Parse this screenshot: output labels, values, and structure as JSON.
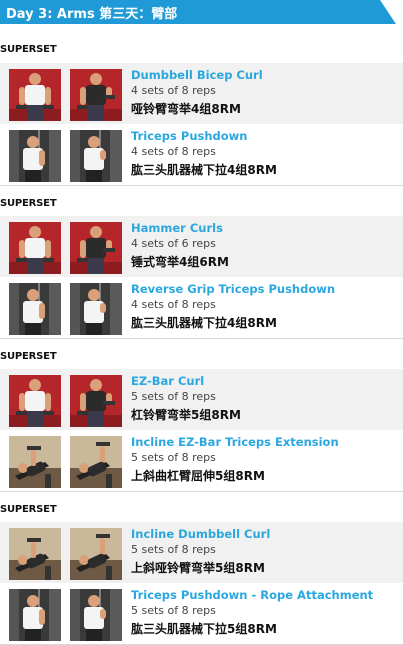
{
  "header": {
    "title": "Day 3: Arms 第三天：臂部",
    "color": "#1f9ad6"
  },
  "supersets": [
    {
      "label": "SUPERSET",
      "exercises": [
        {
          "name": "Dumbbell Bicep Curl",
          "sets": "4 sets of 8 reps",
          "cn": "哑铃臂弯举4组8RM",
          "photo_theme": "red-backdrop"
        },
        {
          "name": "Triceps Pushdown",
          "sets": "4 sets of 8 reps",
          "cn": "肱三头肌器械下拉4组8RM",
          "photo_theme": "gym-machine"
        }
      ]
    },
    {
      "label": "SUPERSET",
      "exercises": [
        {
          "name": "Hammer Curls",
          "sets": "4 sets of 6 reps",
          "cn": "锤式弯举4组6RM",
          "photo_theme": "red-backdrop"
        },
        {
          "name": "Reverse Grip Triceps Pushdown",
          "sets": "4 sets of 8 reps",
          "cn": "肱三头肌器械下拉4组8RM",
          "photo_theme": "gym-machine"
        }
      ]
    },
    {
      "label": "SUPERSET",
      "exercises": [
        {
          "name": "EZ-Bar Curl",
          "sets": "5 sets of 8 reps",
          "cn": "杠铃臂弯举5组8RM",
          "photo_theme": "red-backdrop"
        },
        {
          "name": "Incline EZ-Bar Triceps Extension",
          "sets": "5 sets of 8 reps",
          "cn": "上斜曲杠臂屈伸5组8RM",
          "photo_theme": "bench"
        }
      ]
    },
    {
      "label": "SUPERSET",
      "exercises": [
        {
          "name": "Incline Dumbbell Curl",
          "sets": "5 sets of 8 reps",
          "cn": "上斜哑铃臂弯举5组8RM",
          "photo_theme": "bench"
        },
        {
          "name": "Triceps Pushdown - Rope Attachment",
          "sets": "5 sets of 8 reps",
          "cn": "肱三头肌器械下拉5组8RM",
          "photo_theme": "gym-machine"
        }
      ]
    }
  ]
}
